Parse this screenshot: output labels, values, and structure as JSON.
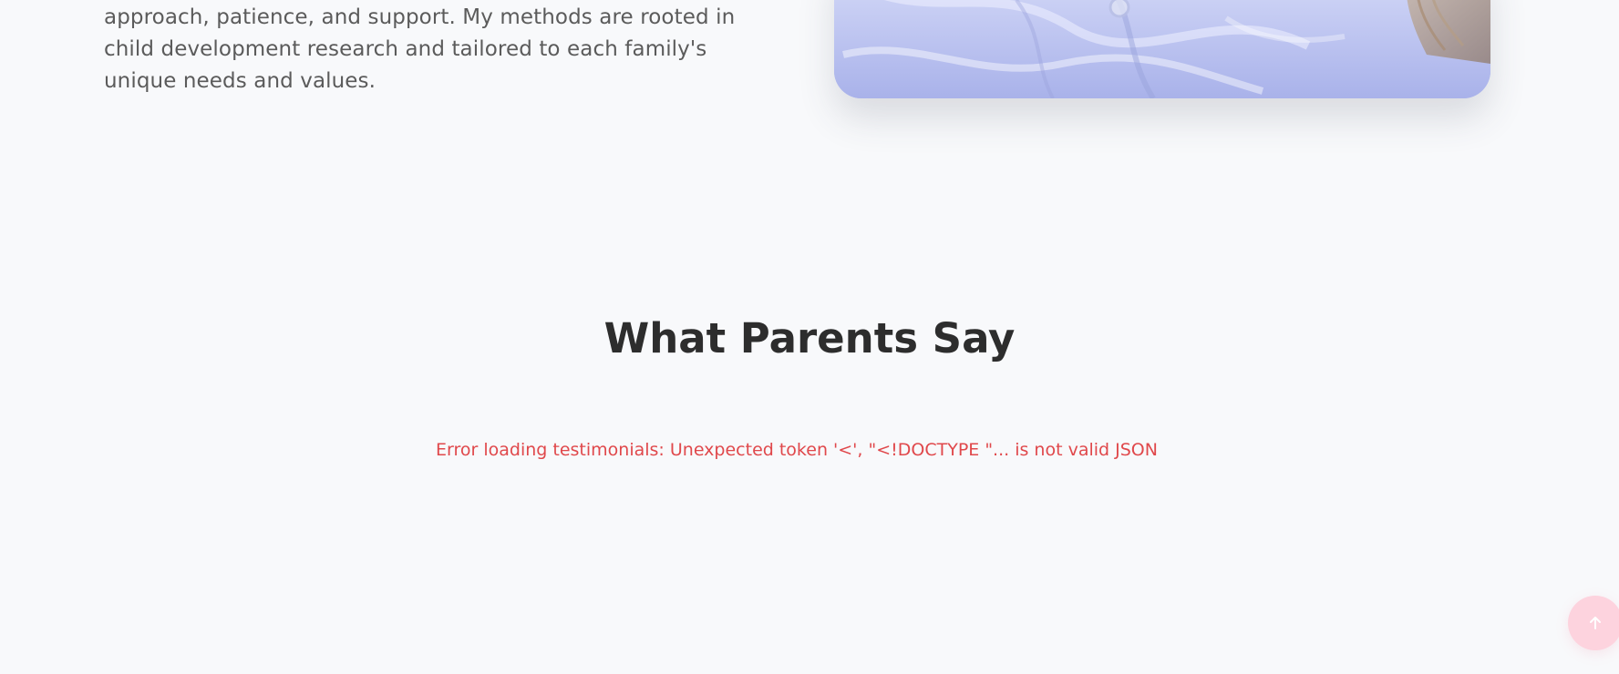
{
  "about": {
    "text": "approach, patience, and support. My methods are rooted in child development research and tailored to each family's unique needs and values.",
    "image": {
      "alt_subject": "child-in-white-shirt-photo"
    }
  },
  "testimonials": {
    "title": "What Parents Say",
    "error": "Error loading testimonials: Unexpected token '<', \"<!DOCTYPE \"... is not valid JSON"
  },
  "scroll_top": {
    "icon": "arrow-up-icon"
  },
  "colors": {
    "background": "#f8f9fb",
    "heading": "#2d2d2d",
    "body_text": "#5b5b5b",
    "error": "#e0484b",
    "scroll_button": "#fdd3de"
  }
}
